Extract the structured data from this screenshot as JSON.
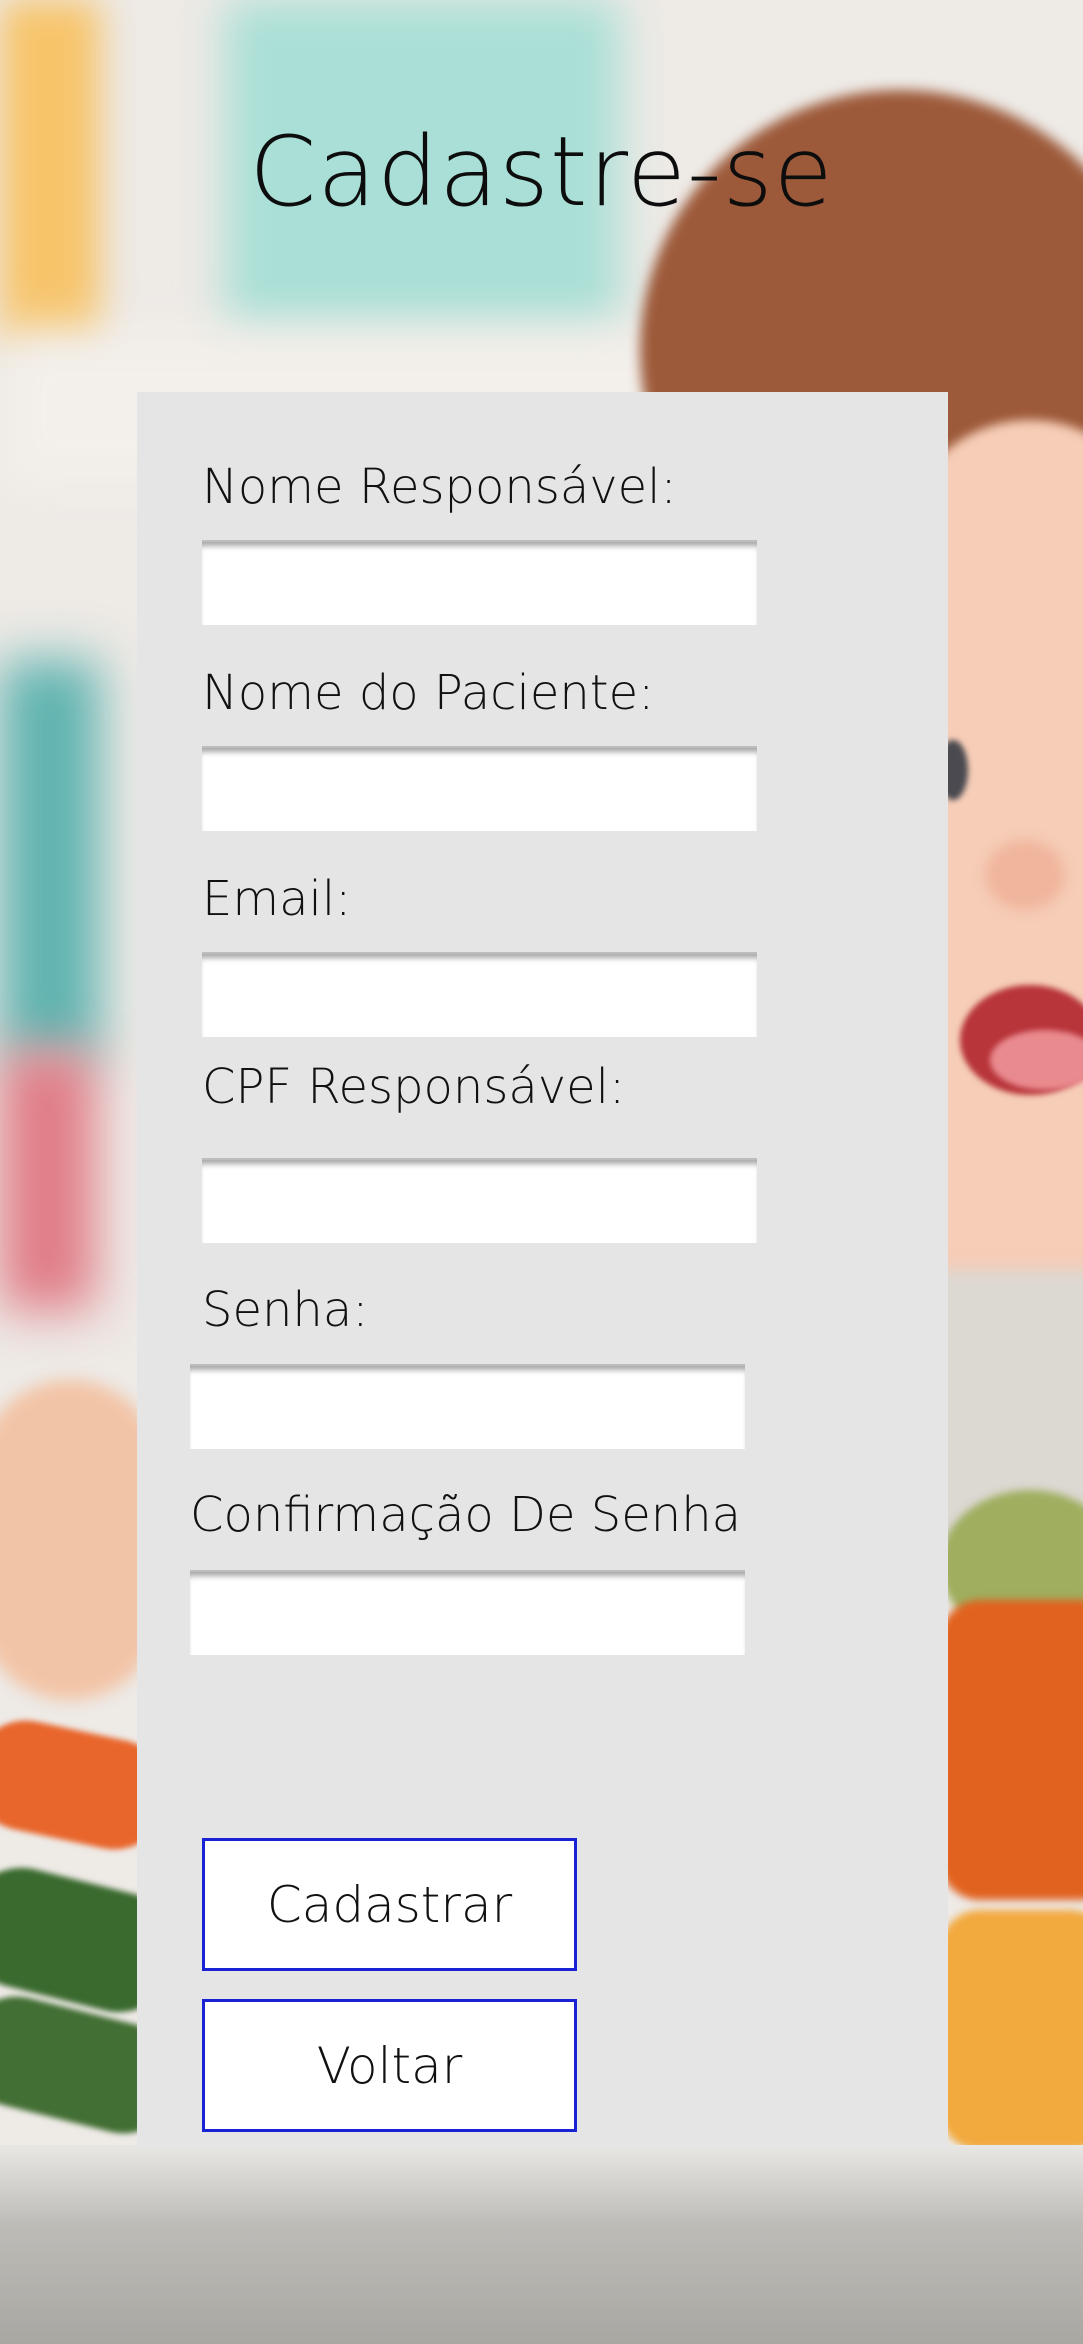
{
  "page": {
    "title": "Cadastre-se"
  },
  "form": {
    "fields": [
      {
        "label": "Nome Responsável:",
        "value": ""
      },
      {
        "label": "Nome do Paciente:",
        "value": ""
      },
      {
        "label": "Email:",
        "value": ""
      },
      {
        "label": "CPF Responsável:",
        "value": ""
      },
      {
        "label": "Senha:",
        "value": ""
      },
      {
        "label": "Confirmação De Senha",
        "value": ""
      }
    ],
    "buttons": {
      "submit_label": "Cadastrar",
      "back_label": "Voltar"
    }
  },
  "colors": {
    "panel_background": "#e5e5e5",
    "button_border": "#1a22d6",
    "input_background": "#ffffff",
    "text": "#111111"
  }
}
